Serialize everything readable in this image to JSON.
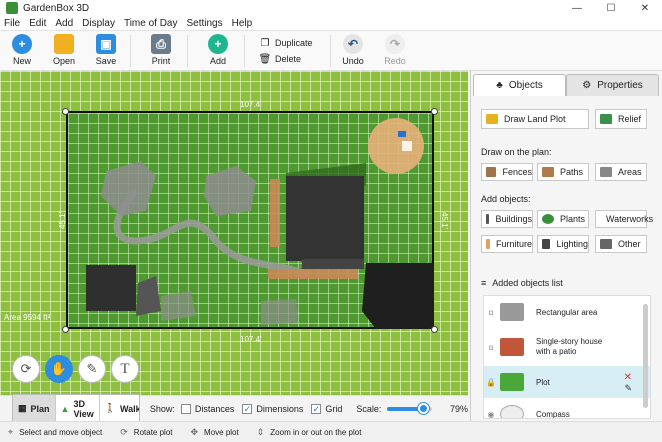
{
  "window": {
    "title": "GardenBox 3D"
  },
  "menu": [
    "File",
    "Edit",
    "Add",
    "Display",
    "Time of Day",
    "Settings",
    "Help"
  ],
  "toolbar": {
    "new": "New",
    "open": "Open",
    "save": "Save",
    "print": "Print",
    "add": "Add",
    "duplicate": "Duplicate",
    "delete": "Delete",
    "undo": "Undo",
    "redo": "Redo"
  },
  "canvas": {
    "dim_top": "107.4'",
    "dim_bottom": "107.4'",
    "dim_left": "45.1'",
    "dim_right": "45.1'",
    "area_label": "Area 9594 ft²"
  },
  "bottombar": {
    "plan": "Plan",
    "view3d": "3D View",
    "walkthrough": "Walkthrough",
    "show": "Show:",
    "distances": "Distances",
    "dimensions": "Dimensions",
    "grid": "Grid",
    "scale": "Scale:",
    "scale_value": "79%",
    "scale_fraction": 0.79
  },
  "status": {
    "select": "Select and move object",
    "rotate": "Rotate plot",
    "move": "Move plot",
    "zoom": "Zoom in or out on the plot"
  },
  "panel": {
    "tab_objects": "Objects",
    "tab_properties": "Properties",
    "draw_land_plot": "Draw Land Plot",
    "relief": "Relief",
    "draw_on_plan": "Draw on the plan:",
    "fences": "Fences",
    "paths": "Paths",
    "areas": "Areas",
    "add_objects": "Add objects:",
    "buildings": "Buildings",
    "plants": "Plants",
    "waterworks": "Waterworks",
    "furniture": "Furniture",
    "lighting": "Lighting",
    "other": "Other",
    "added_list_title": "Added objects list",
    "items": [
      {
        "label": "Rectangular area"
      },
      {
        "label": "Single-story house",
        "label2": "with a patio"
      },
      {
        "label": "Plot"
      },
      {
        "label": "Compass"
      }
    ]
  }
}
